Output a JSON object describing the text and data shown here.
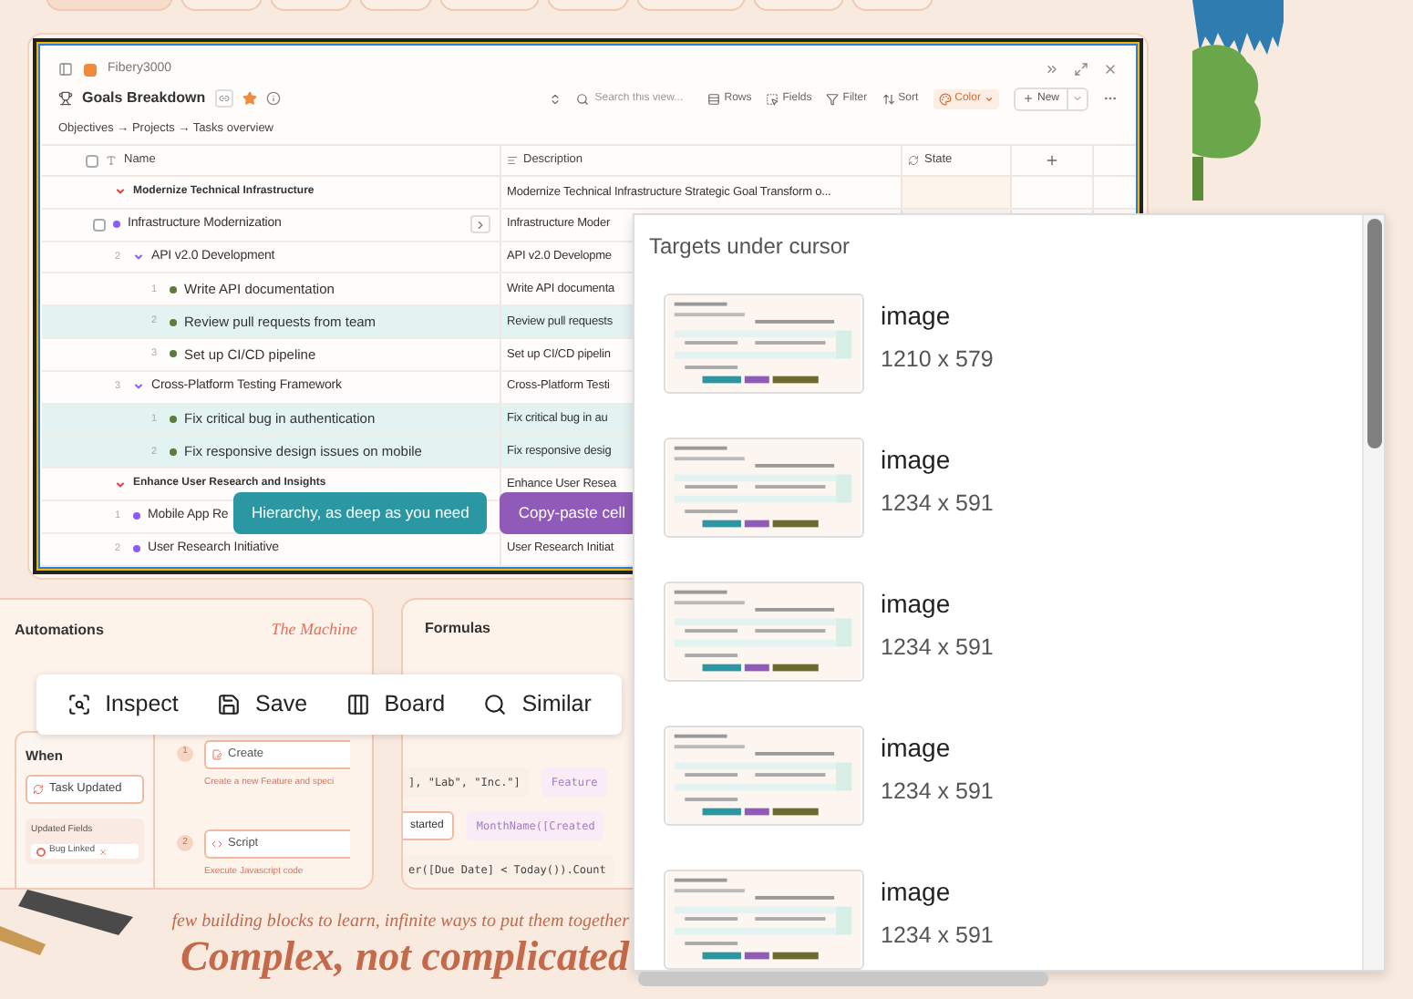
{
  "app_window": {
    "workspace": "Fibery3000",
    "title": "Goals Breakdown",
    "favorite": true,
    "breadcrumb": "Objectives → Projects → Tasks overview",
    "search": {
      "placeholder": "Search this view..."
    },
    "toolbar": [
      {
        "kind": "rows",
        "label": "Rows"
      },
      {
        "kind": "fields",
        "label": "Fields"
      },
      {
        "kind": "filter",
        "label": "Filter"
      },
      {
        "kind": "sort",
        "label": "Sort"
      },
      {
        "kind": "color",
        "label": "Color"
      }
    ],
    "new_button": "New"
  },
  "table": {
    "all_checked": false,
    "columns": [
      "Name",
      "Description",
      "State"
    ],
    "rows": [
      {
        "kind": "goal",
        "name": "Modernize Technical Infrastructure",
        "description": "Modernize Technical Infrastructure Strategic Goal Transform o...",
        "children": [
          {
            "kind": "project",
            "name": "Infrastructure Modernization",
            "description": "Infrastructure Moder",
            "hovered": true,
            "checked": false
          },
          {
            "kind": "project",
            "number": "2",
            "name": "API v2.0 Development",
            "description": "API v2.0 Developme",
            "hovered": false,
            "children": [
              {
                "kind": "task",
                "number": "1",
                "name": "Write API documentation",
                "description": "Write API documenta",
                "selected": false
              },
              {
                "kind": "task",
                "number": "2",
                "name": "Review pull requests from team",
                "description": "Review pull requests",
                "selected": true
              },
              {
                "kind": "task",
                "number": "3",
                "name": "Set up CI/CD pipeline",
                "description": "Set up CI/CD pipelin",
                "selected": false
              }
            ]
          },
          {
            "kind": "project",
            "number": "3",
            "name": "Cross-Platform Testing Framework",
            "description": "Cross-Platform Testi",
            "hovered": false,
            "children": [
              {
                "kind": "task",
                "number": "1",
                "name": "Fix critical bug in authentication",
                "description": "Fix critical bug in au",
                "selected": true
              },
              {
                "kind": "task",
                "number": "2",
                "name": "Fix responsive design issues on mobile",
                "description": "Fix responsive desig",
                "selected": true
              }
            ]
          }
        ]
      },
      {
        "kind": "goal",
        "name": "Enhance User Research and Insights",
        "description": "Enhance User Resea",
        "children": [
          {
            "kind": "project",
            "number": "1",
            "name": "Mobile App Re"
          },
          {
            "kind": "project",
            "number": "2",
            "name": "User Research Initiative",
            "description": "User Research Initiat"
          }
        ]
      }
    ]
  },
  "callouts": [
    {
      "text": "Hierarchy, as deep as you need",
      "color": "#2a97a3"
    },
    {
      "text": "Copy-paste cell",
      "color": "#8f5ab8"
    }
  ],
  "automations": {
    "title": "Automations",
    "tagline": "The Machine",
    "when": "When",
    "trigger": "Task Updated",
    "fields_label": "Updated Fields",
    "field": "Bug Linked",
    "steps": [
      {
        "number": "1",
        "action": "Create",
        "hint": "Create a new Feature and speci"
      },
      {
        "number": "2",
        "action": "Script",
        "hint": "Execute Javascript code"
      }
    ]
  },
  "formulas": {
    "title": "Formulas",
    "chips": [
      [
        "], \"Lab\", \"Inc.\"]",
        "Feature"
      ],
      [
        "started",
        "MonthName([Created"
      ],
      [
        "er([Due Date] < Today()).Count"
      ]
    ]
  },
  "tagline": "few building blocks to learn, infinite ways to put them together",
  "headline": "Complex, not complicated",
  "action_bar": [
    {
      "kind": "inspect",
      "label": "Inspect"
    },
    {
      "kind": "save",
      "label": "Save"
    },
    {
      "kind": "board",
      "label": "Board"
    },
    {
      "kind": "similar",
      "label": "Similar"
    }
  ],
  "targets_panel": {
    "title": "Targets under cursor",
    "items": [
      {
        "kind": "picture",
        "label": "image",
        "size": "1210 x 579"
      },
      {
        "kind": "picture",
        "label": "image",
        "size": "1234 x 591"
      },
      {
        "kind": "picture",
        "label": "image",
        "size": "1234 x 591"
      },
      {
        "kind": "picture",
        "label": "image",
        "size": "1234 x 591"
      },
      {
        "kind": "picture",
        "label": "image",
        "size": "1234 x 591"
      }
    ]
  }
}
